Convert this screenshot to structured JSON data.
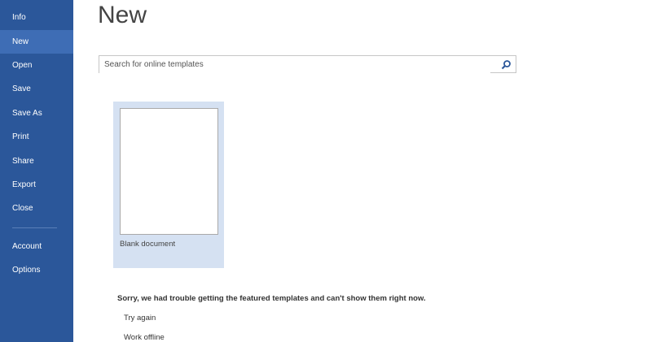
{
  "sidebar": {
    "items": [
      {
        "label": "Info"
      },
      {
        "label": "New",
        "selected": true
      },
      {
        "label": "Open"
      },
      {
        "label": "Save"
      },
      {
        "label": "Save As"
      },
      {
        "label": "Print"
      },
      {
        "label": "Share"
      },
      {
        "label": "Export"
      },
      {
        "label": "Close"
      },
      {
        "label": "Account"
      },
      {
        "label": "Options"
      }
    ]
  },
  "main": {
    "title": "New",
    "search": {
      "placeholder": "Search for online templates",
      "value": ""
    },
    "templates": [
      {
        "label": "Blank document"
      }
    ],
    "error_message": "Sorry, we had trouble getting the featured templates and can't show them right now.",
    "actions": [
      {
        "label": "Try again"
      },
      {
        "label": "Work offline"
      }
    ]
  },
  "colors": {
    "sidebar": "#2b579a",
    "selected": "#3e6db5",
    "tile": "#d5e1f2"
  }
}
